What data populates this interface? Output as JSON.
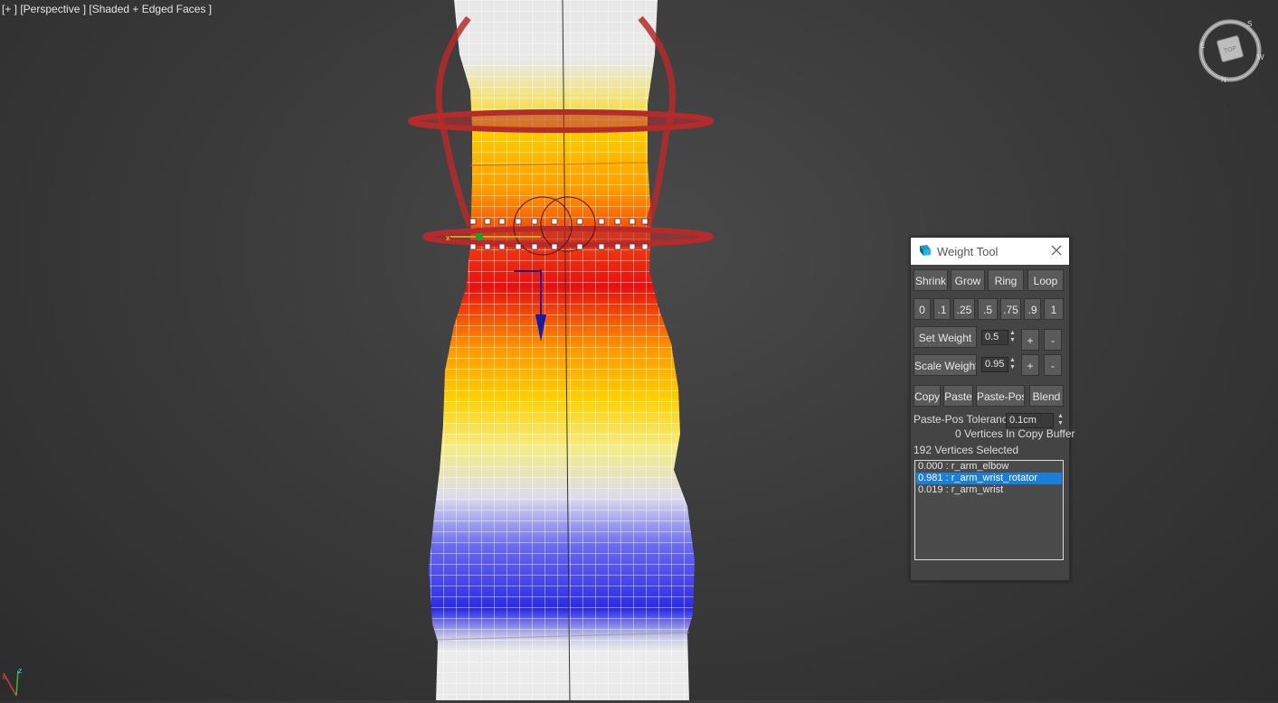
{
  "viewport": {
    "label": "[+ ] [Perspective ] [Shaded + Edged Faces ]",
    "viewcube": {
      "face": "TOP",
      "compass": [
        "S",
        "E",
        "N",
        "W"
      ]
    },
    "axis_tripod": [
      "x",
      "z"
    ],
    "gizmo_axis_label": "x"
  },
  "weight_tool": {
    "title": "Weight Tool",
    "loop_buttons": [
      "Shrink",
      "Grow",
      "Ring",
      "Loop"
    ],
    "preset_buttons": [
      "0",
      ".1",
      ".25",
      ".5",
      ".75",
      ".9",
      "1"
    ],
    "set_weight": {
      "label": "Set Weight",
      "value": "0.5",
      "plus": "+",
      "minus": "-"
    },
    "scale_weight": {
      "label": "Scale Weight",
      "value": "0.95",
      "plus": "+",
      "minus": "-"
    },
    "copy_buttons": [
      "Copy",
      "Paste",
      "Paste-Pos",
      "Blend"
    ],
    "paste_pos_tolerance": {
      "label": "Paste-Pos Tolerance",
      "value": "0.1cm"
    },
    "copy_buffer_status": "0 Vertices In Copy Buffer",
    "selection_status": "192 Vertices Selected",
    "bones": [
      {
        "text": "0.000 : r_arm_elbow",
        "selected": false
      },
      {
        "text": "0.981 : r_arm_wrist_rotator",
        "selected": true
      },
      {
        "text": "0.019 : r_arm_wrist",
        "selected": false
      }
    ]
  },
  "colors": {
    "viewport_bg": "#3b3b3b",
    "panel_bg": "#444444",
    "selection": "#1a7fd9",
    "weight_high": "#e81010",
    "weight_mid": "#ffd200",
    "weight_low": "#2a2ae8",
    "bone_gizmo": "#b52a2a"
  }
}
